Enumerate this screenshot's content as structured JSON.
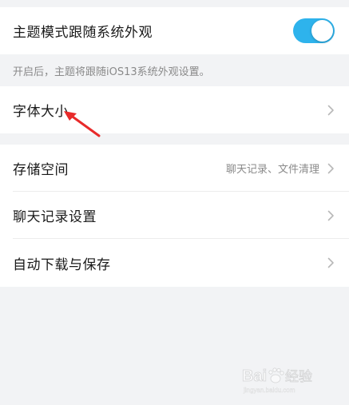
{
  "settings": {
    "follow_system": {
      "label": "主题模式跟随系统外观",
      "enabled": true,
      "toggle_color": "#2eb3ec"
    },
    "note": "开启后，主题将跟随iOS13系统外观设置。",
    "font_size": {
      "label": "字体大小"
    },
    "storage": {
      "label": "存储空间",
      "value": "聊天记录、文件清理"
    },
    "chat_history": {
      "label": "聊天记录设置"
    },
    "auto_download": {
      "label": "自动下载与保存"
    }
  },
  "annotation": {
    "arrow_color": "#e82a2a",
    "target": "字体大小"
  },
  "watermark": {
    "brand": "Baidu",
    "subtitle": "经验",
    "url": "jingyan.baidu.com"
  },
  "colors": {
    "background": "#f2f3f5",
    "row_background": "#ffffff",
    "text_primary": "#1a1a1a",
    "text_secondary": "#8a8a8a",
    "chevron": "#b8b8b8"
  }
}
